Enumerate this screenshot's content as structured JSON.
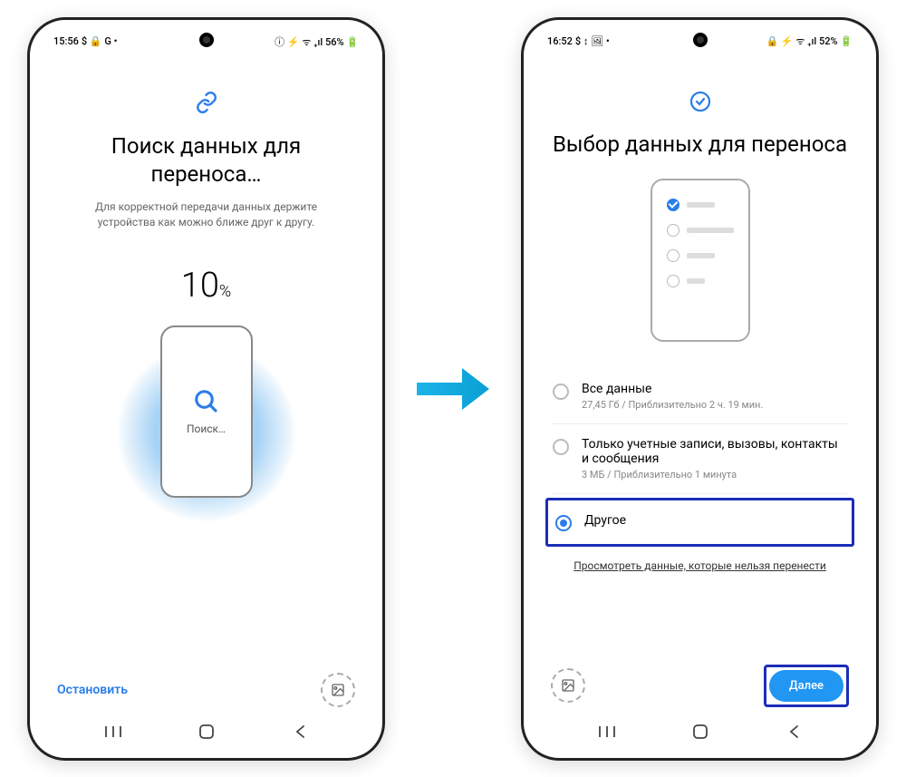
{
  "screen1": {
    "status": {
      "time": "15:56",
      "left_icons": "$ 🔒 G •",
      "right_icons": "ⓘ ⚡ ᯤ ₊ıl 56% 🔋",
      "battery": "56%"
    },
    "title": "Поиск данных для переноса…",
    "subtitle": "Для корректной передачи данных держите устройства как можно ближе друг к другу.",
    "progress_value": "10",
    "progress_unit": "%",
    "search_label": "Поиск…",
    "stop": "Остановить"
  },
  "screen2": {
    "status": {
      "time": "16:52",
      "left_icons": "$ ↕ 🖼 •",
      "right_icons": "🔒 ⚡ ᯤ ₊ıl 52% 🔋",
      "battery": "52%"
    },
    "title": "Выбор данных для переноса",
    "options": [
      {
        "title": "Все данные",
        "sub": "27,45 Гб / Приблизительно 2 ч. 19 мин."
      },
      {
        "title": "Только учетные записи, вызовы, контакты и сообщения",
        "sub": "3 МБ / Приблизительно 1 минута"
      },
      {
        "title": "Другое",
        "sub": ""
      }
    ],
    "link": "Просмотреть данные, которые нельзя перенести",
    "next": "Далее"
  }
}
